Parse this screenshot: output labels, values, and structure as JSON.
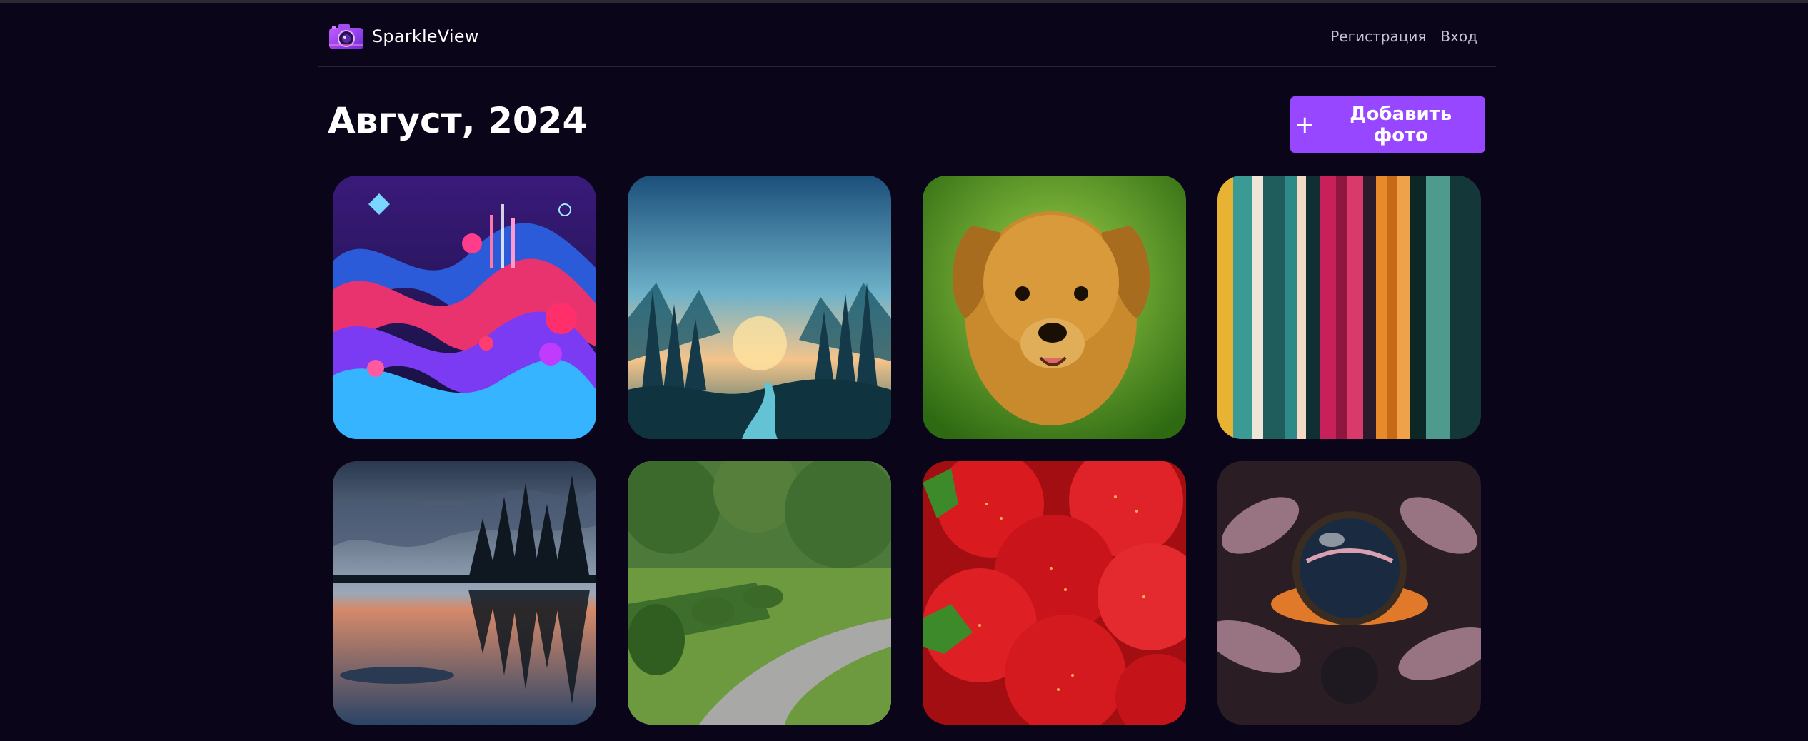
{
  "header": {
    "brand_name": "SparkleView",
    "logo_icon": "camera-icon",
    "nav": {
      "register_label": "Регистрация",
      "login_label": "Вход"
    }
  },
  "main": {
    "title": "Август, 2024",
    "add_photo_label": "Добавить фото",
    "add_photo_icon": "plus-icon",
    "accent_color": "#9747ff",
    "photos": [
      {
        "subject": "abstract-music-waves"
      },
      {
        "subject": "forest-valley-sunset"
      },
      {
        "subject": "puppy"
      },
      {
        "subject": "colorful-stripes"
      },
      {
        "subject": "lake-reflection"
      },
      {
        "subject": "park-path"
      },
      {
        "subject": "strawberries"
      },
      {
        "subject": "water-droplet-flower"
      }
    ]
  }
}
